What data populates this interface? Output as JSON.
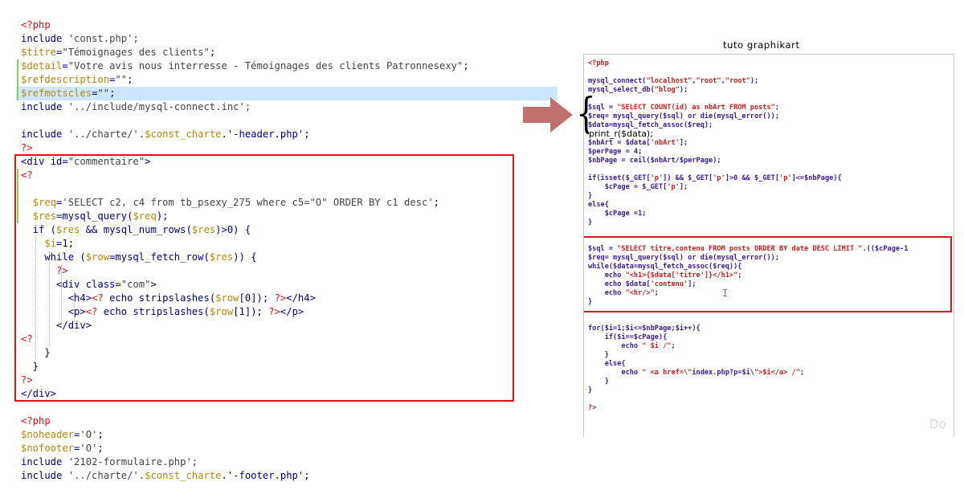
{
  "left_editor": {
    "lines": [
      [
        "<?php"
      ],
      [
        "include",
        " 'const.php';"
      ],
      [
        "$titre",
        "=",
        "\"Témoignages des clients\"",
        ";"
      ],
      [
        "$detail",
        "=",
        "\"Votre avis nous interresse - Témoignages des clients Patronnesexy\"",
        ";"
      ],
      [
        "$refdescription",
        "=",
        "\"\"",
        ";"
      ],
      [
        "$refmotscles",
        "=",
        "\"\"",
        ";"
      ],
      [
        "include",
        " '../include/mysql-connect.inc';"
      ],
      [
        ""
      ],
      [
        "include",
        " '../charte/'.",
        "$const_charte",
        ".'-header.php';"
      ],
      [
        "?>"
      ],
      [
        "<div",
        " id=",
        "\"commentaire\"",
        ">"
      ],
      [
        "<?"
      ],
      [
        ""
      ],
      [
        "  ",
        "$req",
        "=",
        "'SELECT c2, c4 from tb_psexy_275 where c5=\"O\" ORDER BY c1 desc'",
        ";"
      ],
      [
        "  ",
        "$res",
        "=",
        "mysql_query(",
        "$req",
        ");"
      ],
      [
        "  if (",
        "$res",
        " && mysql_num_rows(",
        "$res",
        ")>0) {"
      ],
      [
        "    ",
        "$i",
        "=1;"
      ],
      [
        "    while (",
        "$row",
        "=mysql_fetch_row(",
        "$res",
        ")) {"
      ],
      [
        "      ",
        "?>"
      ],
      [
        "      <div",
        " class=",
        "\"com\"",
        ">"
      ],
      [
        "        <h4>",
        "<?",
        " echo stripslashes(",
        "$row",
        "[0]); ",
        "?>",
        "</h4>"
      ],
      [
        "        <p>",
        "<?",
        " echo stripslashes(",
        "$row",
        "[1]); ",
        "?>",
        "</p>"
      ],
      [
        "      </div>"
      ],
      [
        "<?"
      ],
      [
        "    }"
      ],
      [
        "  }"
      ],
      [
        "?>"
      ],
      [
        "</div>"
      ],
      [
        ""
      ],
      [
        "<?php"
      ],
      [
        "$noheader",
        "=",
        "'O'",
        ";"
      ],
      [
        "$nofooter",
        "=",
        "'O'",
        ";"
      ],
      [
        "include",
        " '2102-formulaire.php';"
      ],
      [
        "include",
        " '../charte/'.",
        "$const_charte",
        ".'-footer.php';"
      ]
    ]
  },
  "caption": "tuto graphikart",
  "annotation": {
    "print_r": "print_r($data);"
  },
  "tutorial_code": {
    "lines": [
      "<?php",
      "",
      "mysql_connect(\"localhost\",\"root\",\"root\");",
      "mysql_select_db(\"blog\");",
      "",
      "$sql = \"SELECT COUNT(id) as nbArt FROM posts\";",
      "$req= mysql_query($sql) or die(mysql_error());",
      "$data=mysql_fetch_assoc($req);",
      "",
      "$nbArt = $data['nbArt'];",
      "$perPage = 4;",
      "$nbPage = ceil($nbArt/$perPage);",
      "",
      "if(isset($_GET['p']) && $_GET['p']>0 && $_GET['p']<=$nbPage){",
      "    $cPage = $_GET['p'];",
      "}",
      "else{",
      "    $cPage =1;",
      "}",
      "",
      "",
      "$sql = \"SELECT titre,contenu FROM posts ORDER BY date DESC LIMIT \".(($cPage-1",
      "$req= mysql_query($sql) or die(mysql_error());",
      "while($data=mysql_fetch_assoc($req)){",
      "    echo \"<h1>{$data['titre']}</h1>\";",
      "    echo $data['contenu'];",
      "    echo \"<hr/>\";",
      "}",
      "",
      "",
      "for($i=1;$i<=$nbPage;$i++){",
      "    if($i==$cPage){",
      "        echo \" $i /\";",
      "    }",
      "    else{",
      "        echo \" <a href=\\\"index.php?p=$i\\\">$i</a> /\";",
      "    }",
      "}",
      "",
      "?>"
    ]
  },
  "watermark": "Do",
  "colors": {
    "highlight_line": "#cde6fb",
    "red_box": "#e1141b",
    "arrow": "#c0706e",
    "php_tag": "#e01010",
    "variable": "#b8860b",
    "keyword": "#000080"
  }
}
